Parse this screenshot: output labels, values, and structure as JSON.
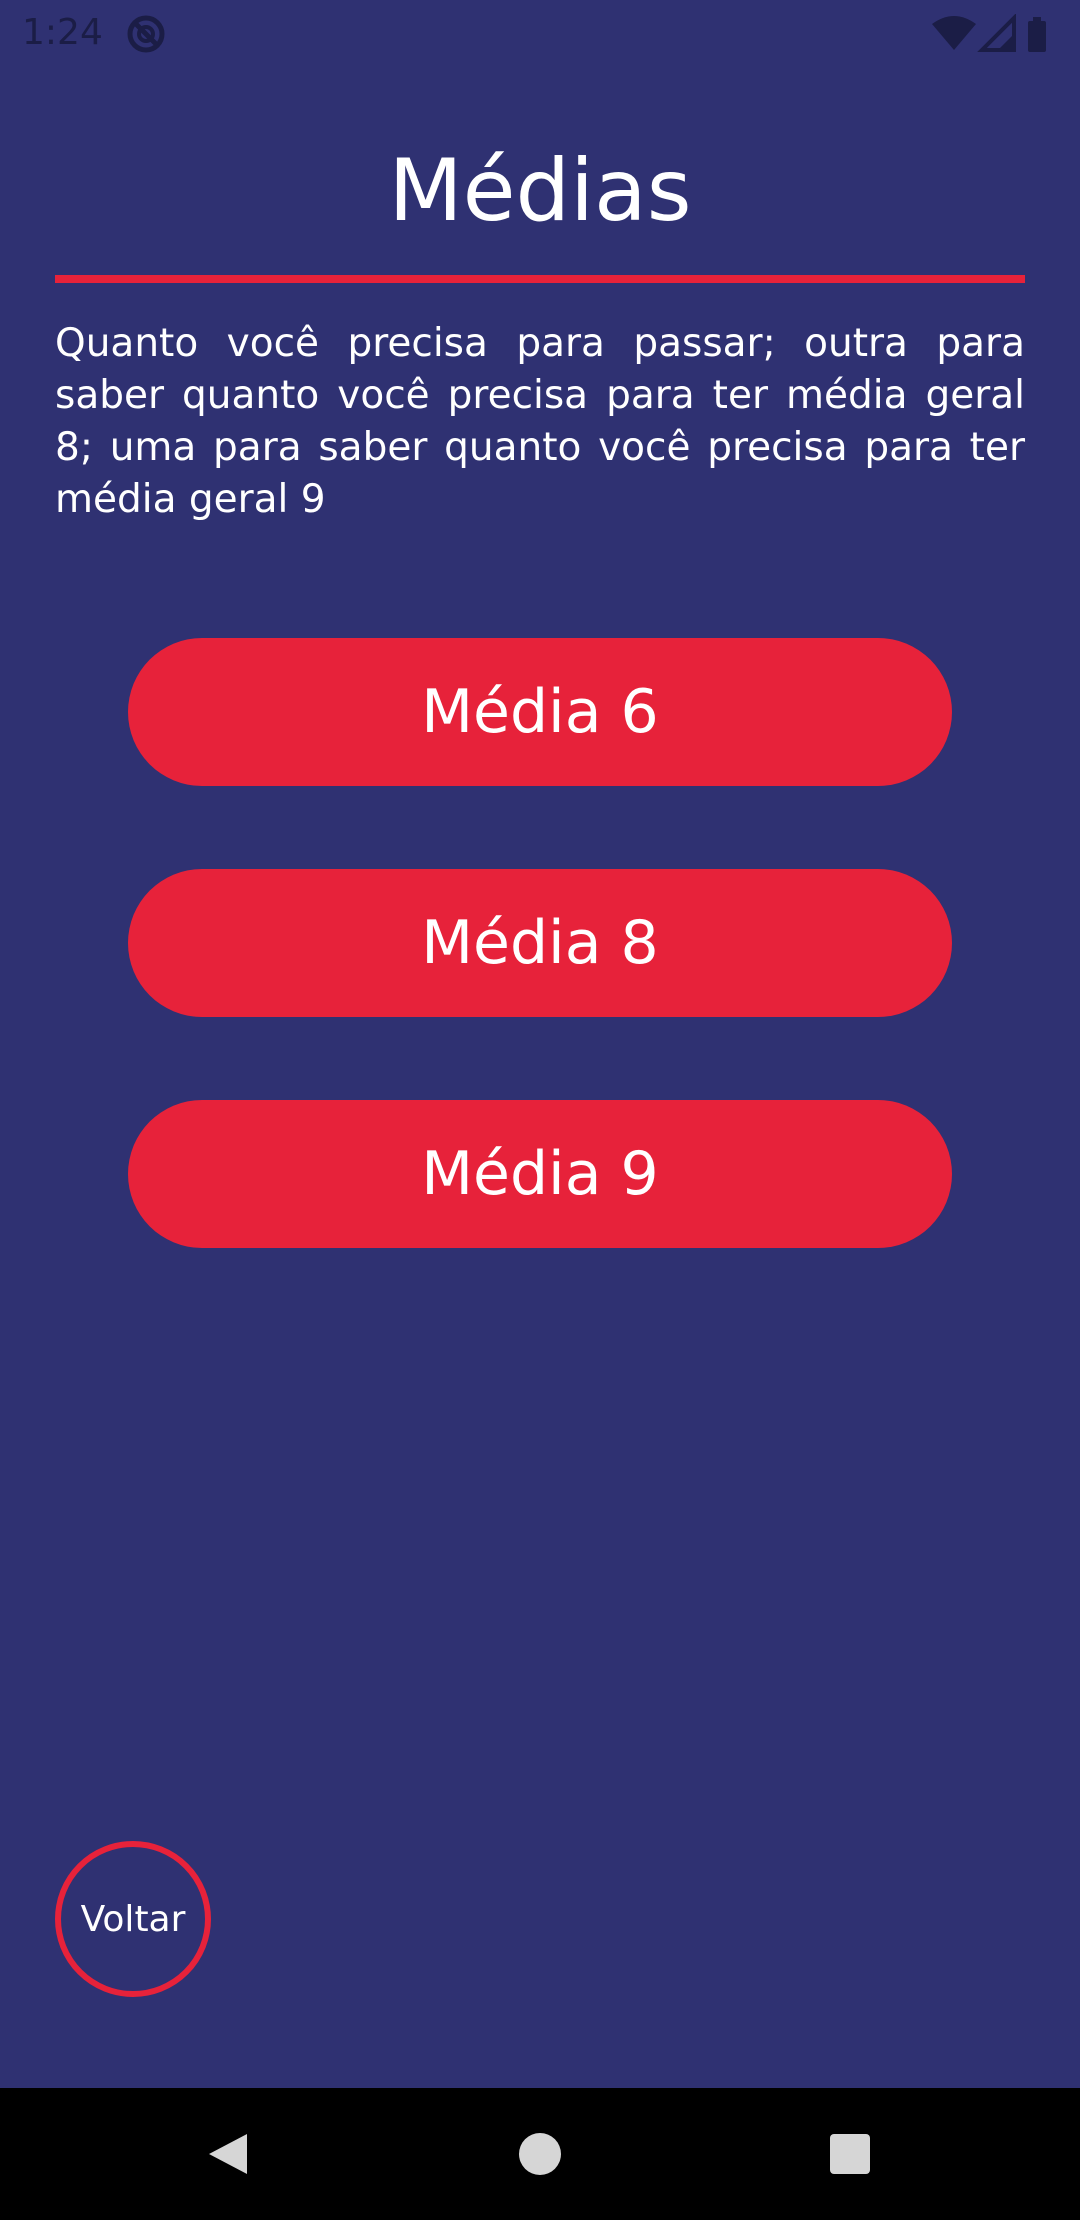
{
  "status_bar": {
    "time": "1:24",
    "icons": [
      "do-not-disturb-icon",
      "wifi-icon",
      "signal-icon",
      "battery-icon"
    ]
  },
  "page": {
    "title": "Médias",
    "description": "Quanto você precisa para passar; outra para saber quanto você precisa para ter média geral 8; uma para saber quanto você precisa para ter média geral 9"
  },
  "buttons": {
    "media6": "Média 6",
    "media8": "Média 8",
    "media9": "Média 9",
    "back": "Voltar"
  },
  "navigation_bar": {
    "icons": [
      "back-icon",
      "home-icon",
      "recents-icon"
    ]
  },
  "colors": {
    "background": "#2f3172",
    "accent": "#e7223a",
    "text": "#ffffff"
  }
}
